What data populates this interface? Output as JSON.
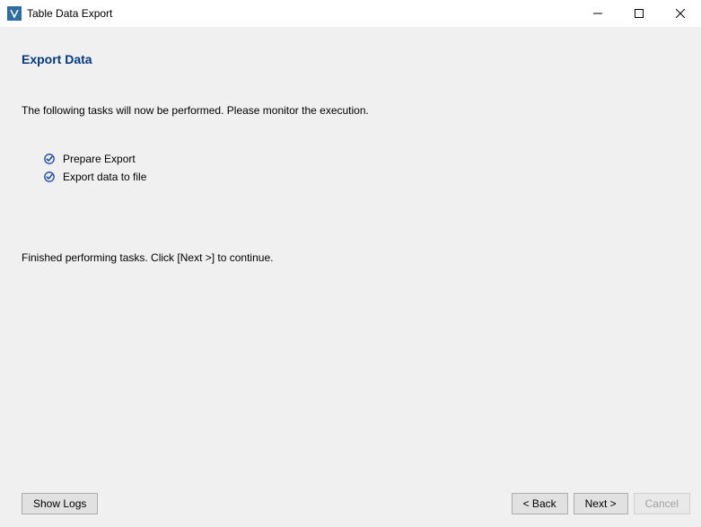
{
  "titlebar": {
    "title": "Table Data Export"
  },
  "page": {
    "heading": "Export Data",
    "instruction": "The following tasks will now be performed. Please monitor the execution.",
    "finished_text": "Finished performing tasks. Click [Next >] to continue."
  },
  "tasks": [
    {
      "label": "Prepare Export",
      "done": true
    },
    {
      "label": "Export data to file",
      "done": true
    }
  ],
  "footer": {
    "show_logs": "Show Logs",
    "back": "< Back",
    "next": "Next >",
    "cancel": "Cancel"
  }
}
